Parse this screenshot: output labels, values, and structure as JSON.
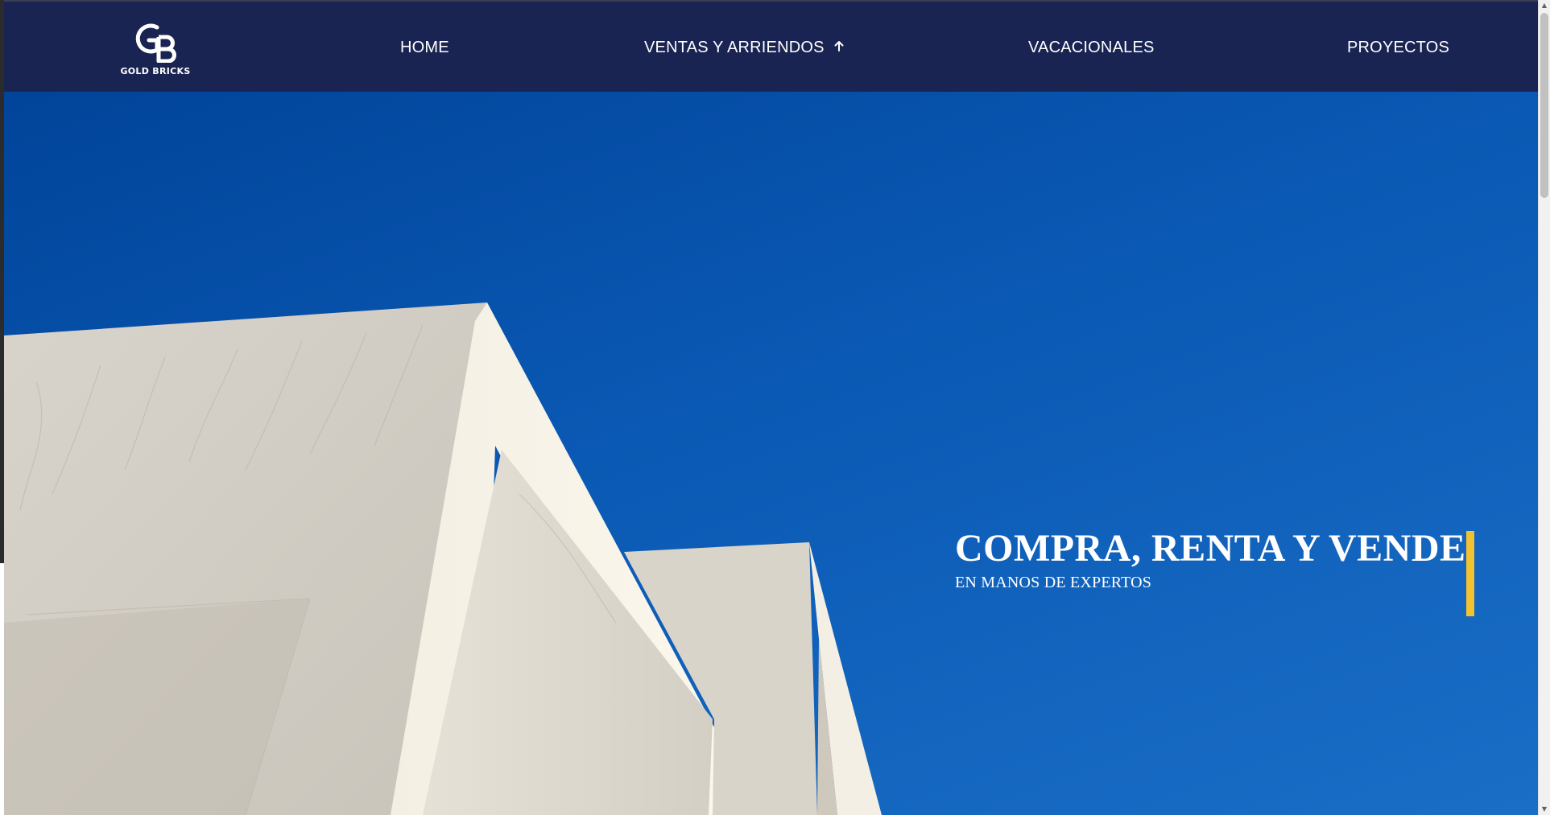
{
  "brand": {
    "logo_monogram": "GB",
    "logo_text": "GOLD BRICKS"
  },
  "nav": {
    "items": [
      {
        "label": "HOME"
      },
      {
        "label": "VENTAS Y ARRIENDOS",
        "icon": "arrow-up-icon"
      },
      {
        "label": "VACACIONALES"
      },
      {
        "label": "PROYECTOS"
      }
    ]
  },
  "hero": {
    "title": "COMPRA, RENTA Y VENDE",
    "subtitle": "EN MANOS DE EXPERTOS"
  },
  "colors": {
    "header_bg": "#1a2453",
    "hero_sky": "#0a59b4",
    "accent": "#f2c230",
    "text": "#ffffff"
  },
  "scrollbar": {
    "up_icon": "▲",
    "down_icon": "▼"
  }
}
